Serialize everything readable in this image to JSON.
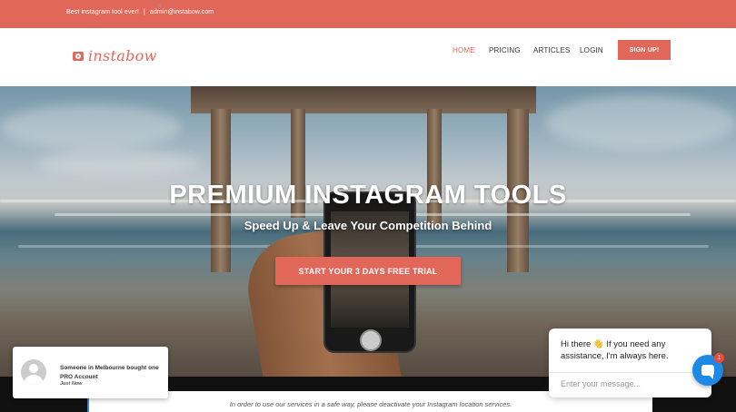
{
  "topbar": {
    "tagline": "Best instagram tool ever!",
    "separator": "|",
    "email": "admin@instabow.com"
  },
  "brand": {
    "name": "instabow",
    "accent": "#e1675a"
  },
  "nav": {
    "items": [
      {
        "label": "HOME",
        "active": true
      },
      {
        "label": "PRICING",
        "active": false
      },
      {
        "label": "ARTICLES",
        "active": false
      },
      {
        "label": "LOGIN",
        "active": false
      }
    ],
    "signup_label": "SIGN UP!"
  },
  "hero": {
    "title": "PREMIUM INSTAGRAM TOOLS",
    "subtitle": "Speed Up & Leave Your Competition Behind",
    "cta_label": "START YOUR 3 DAYS FREE TRIAL"
  },
  "notice": {
    "text": "In order to use our services in a safe way, please deactivate your Instagram location services."
  },
  "toast": {
    "message": "Someone in Melbourne bought one PRO Account",
    "time": "Just Now",
    "close": "×"
  },
  "chat": {
    "message": "Hi there 👋 If you need any assistance, I'm always here.",
    "placeholder": "Enter your message...",
    "badge_count": "1",
    "fab_color": "#1e88e5"
  }
}
